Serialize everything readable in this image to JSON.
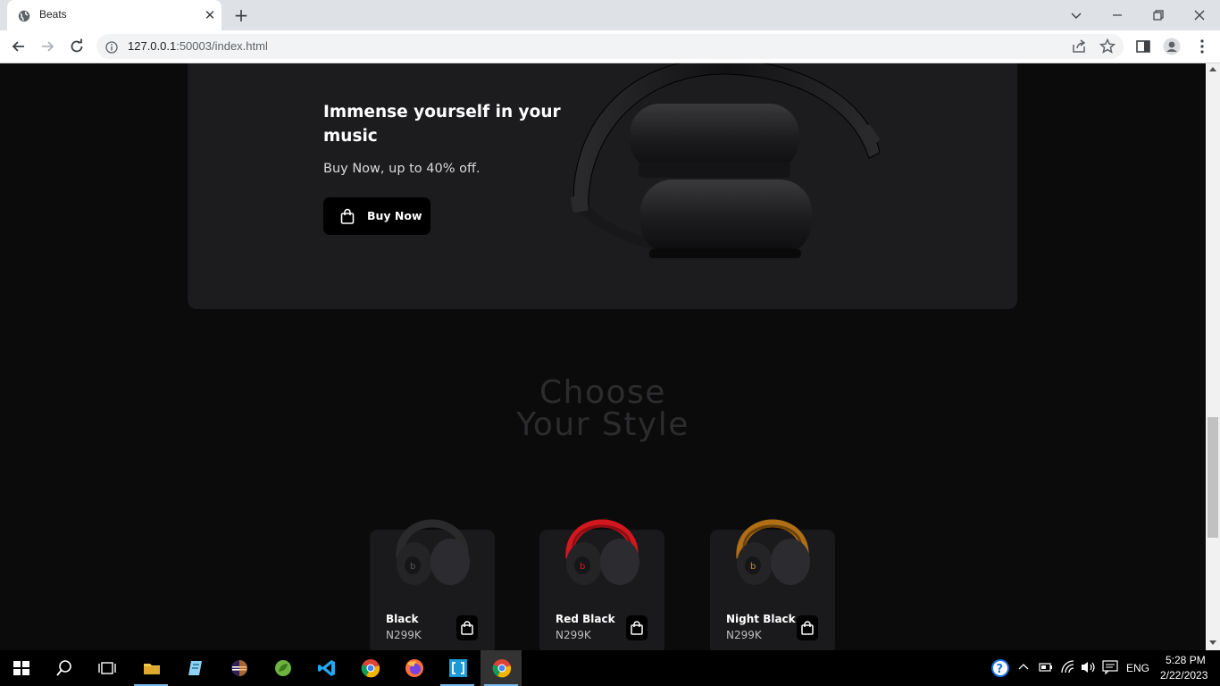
{
  "browser": {
    "tab_title": "Beats",
    "url_host": "127.0.0.1",
    "url_path": ":50003/index.html"
  },
  "promo": {
    "title": "Immense yourself in your music",
    "subtitle": "Buy Now, up to 40% off.",
    "button_label": "Buy Now"
  },
  "styles": {
    "title_line1": "Choose",
    "title_line2": "Your Style",
    "products": [
      {
        "name": "Black",
        "price": "N299K",
        "accent": "#1e1e20"
      },
      {
        "name": "Red Black",
        "price": "N299K",
        "accent": "#d3171f"
      },
      {
        "name": "Night Black",
        "price": "N299K",
        "accent": "#b06f16"
      }
    ]
  },
  "taskbar": {
    "language": "ENG",
    "time": "5:28 PM",
    "date": "2/22/2023"
  },
  "colors": {
    "page_bg": "#0b0b0b",
    "panel_bg": "#1c1c1f",
    "title_dim": "#2c2c2e"
  }
}
